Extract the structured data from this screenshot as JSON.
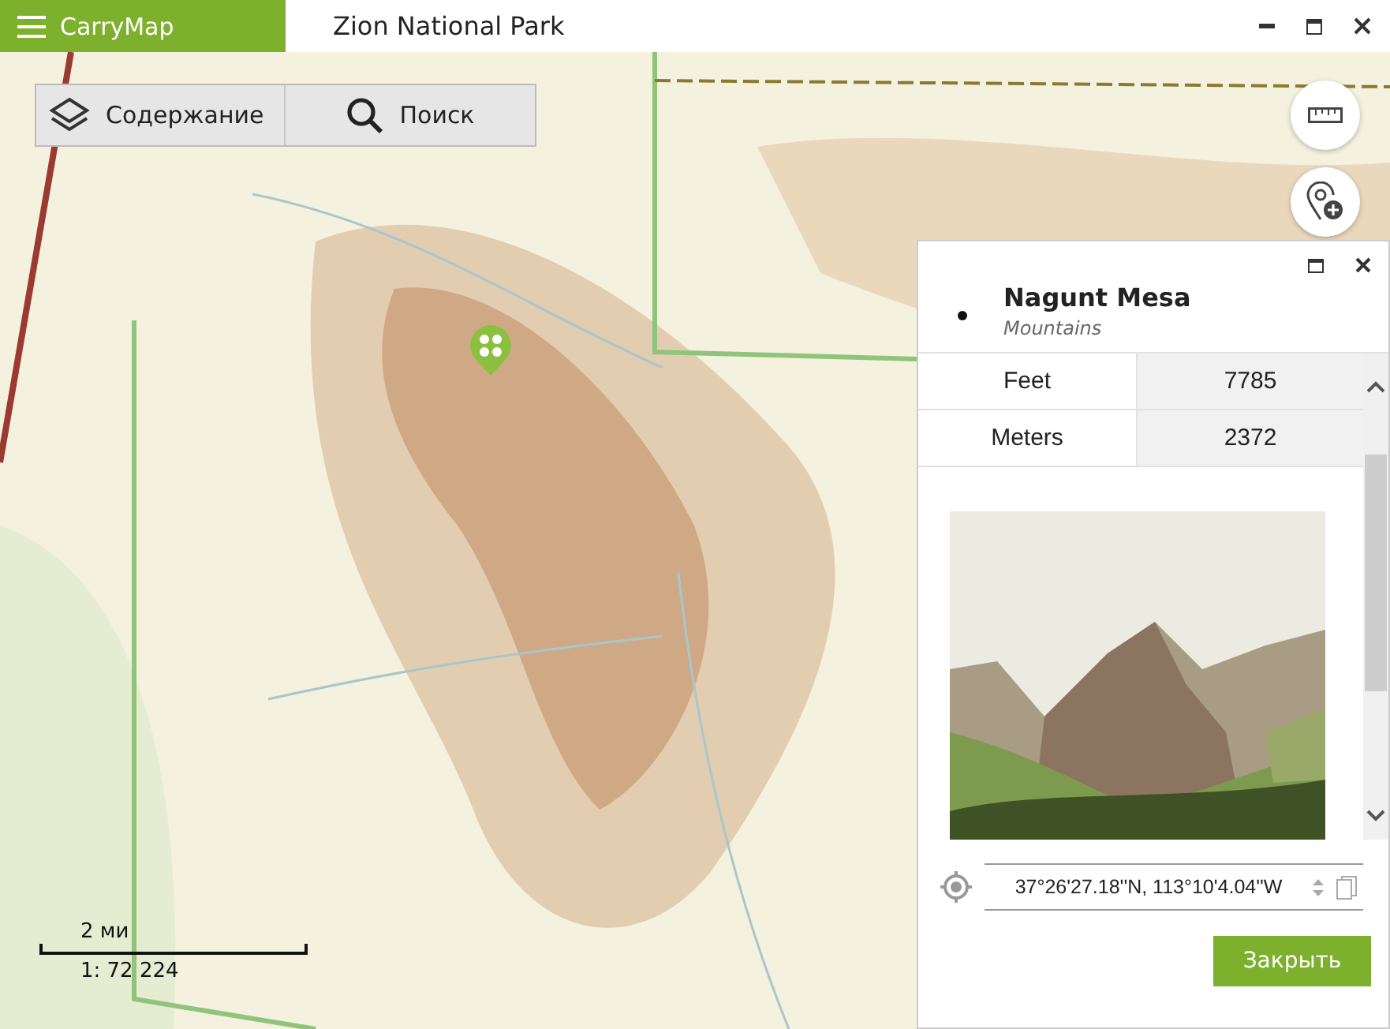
{
  "app": {
    "name": "CarryMap",
    "title": "Zion National Park"
  },
  "toolbar": [
    {
      "kind": "layers",
      "label": "Содержание"
    },
    {
      "kind": "search",
      "label": "Поиск"
    }
  ],
  "scale": {
    "distance": "2 ми",
    "ratio": "1: 72 224"
  },
  "feature": {
    "name": "Nagunt Mesa",
    "category": "Mountains",
    "attributes": [
      {
        "name": "Feet",
        "value": "7785"
      },
      {
        "name": "Meters",
        "value": "2372"
      }
    ],
    "coordinates": "37°26'27.18''N, 113°10'4.04''W",
    "close_button": "Закрыть"
  }
}
